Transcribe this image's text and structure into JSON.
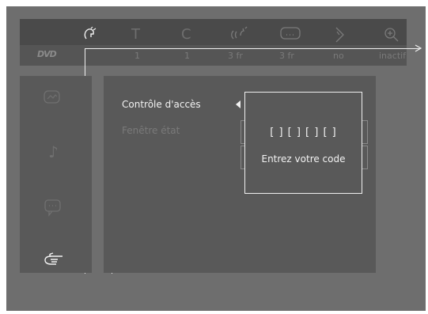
{
  "topbar": {
    "icons": [
      {
        "name": "angle-icon",
        "glyph": "↻",
        "active": true
      },
      {
        "name": "title-icon",
        "glyph": "T",
        "active": false
      },
      {
        "name": "chapter-icon",
        "glyph": "C",
        "active": false
      },
      {
        "name": "audio-icon",
        "glyph": "((ʼ",
        "active": false
      },
      {
        "name": "subtitle-icon",
        "glyph": "…",
        "active": false
      },
      {
        "name": "angle-select-icon",
        "glyph": "◇",
        "active": false
      },
      {
        "name": "zoom-icon",
        "glyph": "⊕",
        "active": false
      }
    ]
  },
  "valuebar": {
    "logo": "DVD",
    "values": [
      "1",
      "1",
      "3 fr",
      "3 fr",
      "no",
      "inactif"
    ]
  },
  "sidebar": {
    "icons": [
      {
        "name": "picture-icon",
        "glyph": "⌇",
        "active": false
      },
      {
        "name": "sound-icon",
        "glyph": "♪",
        "active": false
      },
      {
        "name": "language-icon",
        "glyph": "💬",
        "active": false
      },
      {
        "name": "features-icon",
        "glyph": "☜",
        "active": true
      }
    ]
  },
  "menu": {
    "items": [
      {
        "label": "Contrôle d'accès",
        "selected": true
      },
      {
        "label": "Fenêtre état",
        "selected": false
      }
    ]
  },
  "popup": {
    "code": "[ ] [ ] [ ] [ ]",
    "prompt": "Entrez votre code"
  },
  "colors": {
    "screen_bg": "#6e6e6e",
    "panel_bg": "#595959",
    "topbar_bg": "#4a4a4a",
    "highlight": "#f2f2f2",
    "dim_text": "#7a7a7a"
  }
}
